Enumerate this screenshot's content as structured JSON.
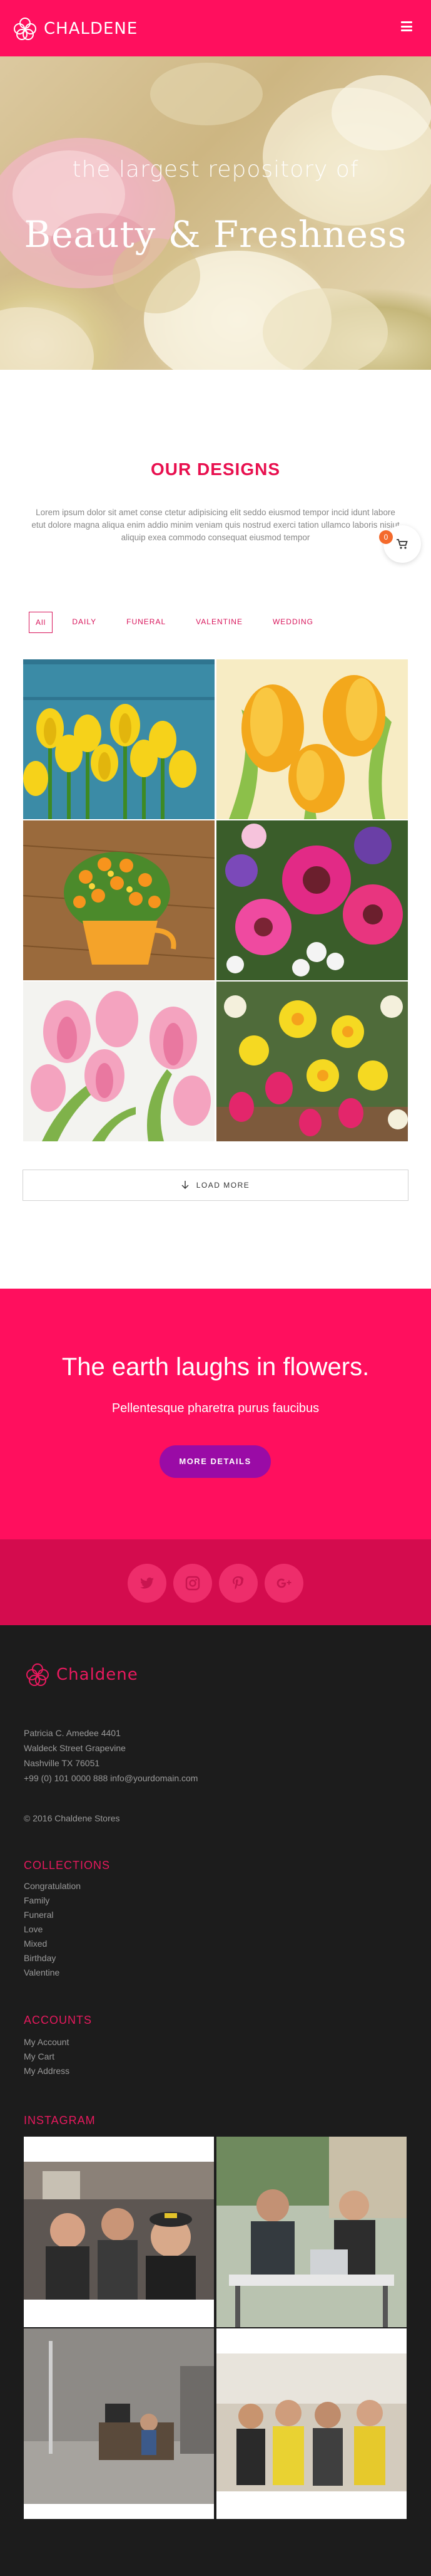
{
  "header": {
    "brand": "CHALDENE",
    "menu_icon": "hamburger-menu-icon"
  },
  "hero": {
    "subtitle": "the largest repository of",
    "title": "Beauty & Freshness"
  },
  "designs": {
    "title": "OUR DESIGNS",
    "text": "Lorem ipsum dolor sit amet conse ctetur adipisicing elit seddo eiusmod tempor incid idunt labore etut dolore magna aliqua enim addio minim veniam quis nostrud exerci tation ullamco laboris nisiut aliquip exea commodo consequat eiusmod tempor",
    "cart_count": "0",
    "filters": [
      "All",
      "DAILY",
      "FUNERAL",
      "VALENTINE",
      "WEDDING"
    ],
    "active_filter": "All",
    "tiles": [
      "yellow-tulips",
      "orange-tulips",
      "potted-flowers",
      "pink-gerberas",
      "pink-tulips",
      "mixed-bouquet"
    ],
    "load_more": "LOAD MORE"
  },
  "quote": {
    "title": "The earth laughs in flowers.",
    "subtitle": "Pellentesque pharetra purus faucibus",
    "button": "MORE DETAILS"
  },
  "social": {
    "icons": [
      "twitter-icon",
      "instagram-icon",
      "pinterest-icon",
      "google-plus-icon"
    ]
  },
  "footer": {
    "brand": "Chaldene",
    "address": [
      "Patricia C. Amedee 4401",
      "Waldeck Street Grapevine",
      "Nashville TX 76051",
      "+99 (0) 101 0000 888 info@yourdomain.com"
    ],
    "copyright": "© 2016 Chaldene Stores",
    "collections_title": "COLLECTIONS",
    "collections": [
      "Congratulation",
      "Family",
      "Funeral",
      "Love",
      "Mixed",
      "Birthday",
      "Valentine"
    ],
    "accounts_title": "ACCOUNTS",
    "accounts": [
      "My Account",
      "My Cart",
      "My Address"
    ],
    "instagram_title": "INSTAGRAM"
  },
  "colors": {
    "brand_pink": "#ff0f5e",
    "social_band": "#d40c4e",
    "button_purple": "#9a0ba6",
    "footer_bg": "#1c1c1c"
  }
}
